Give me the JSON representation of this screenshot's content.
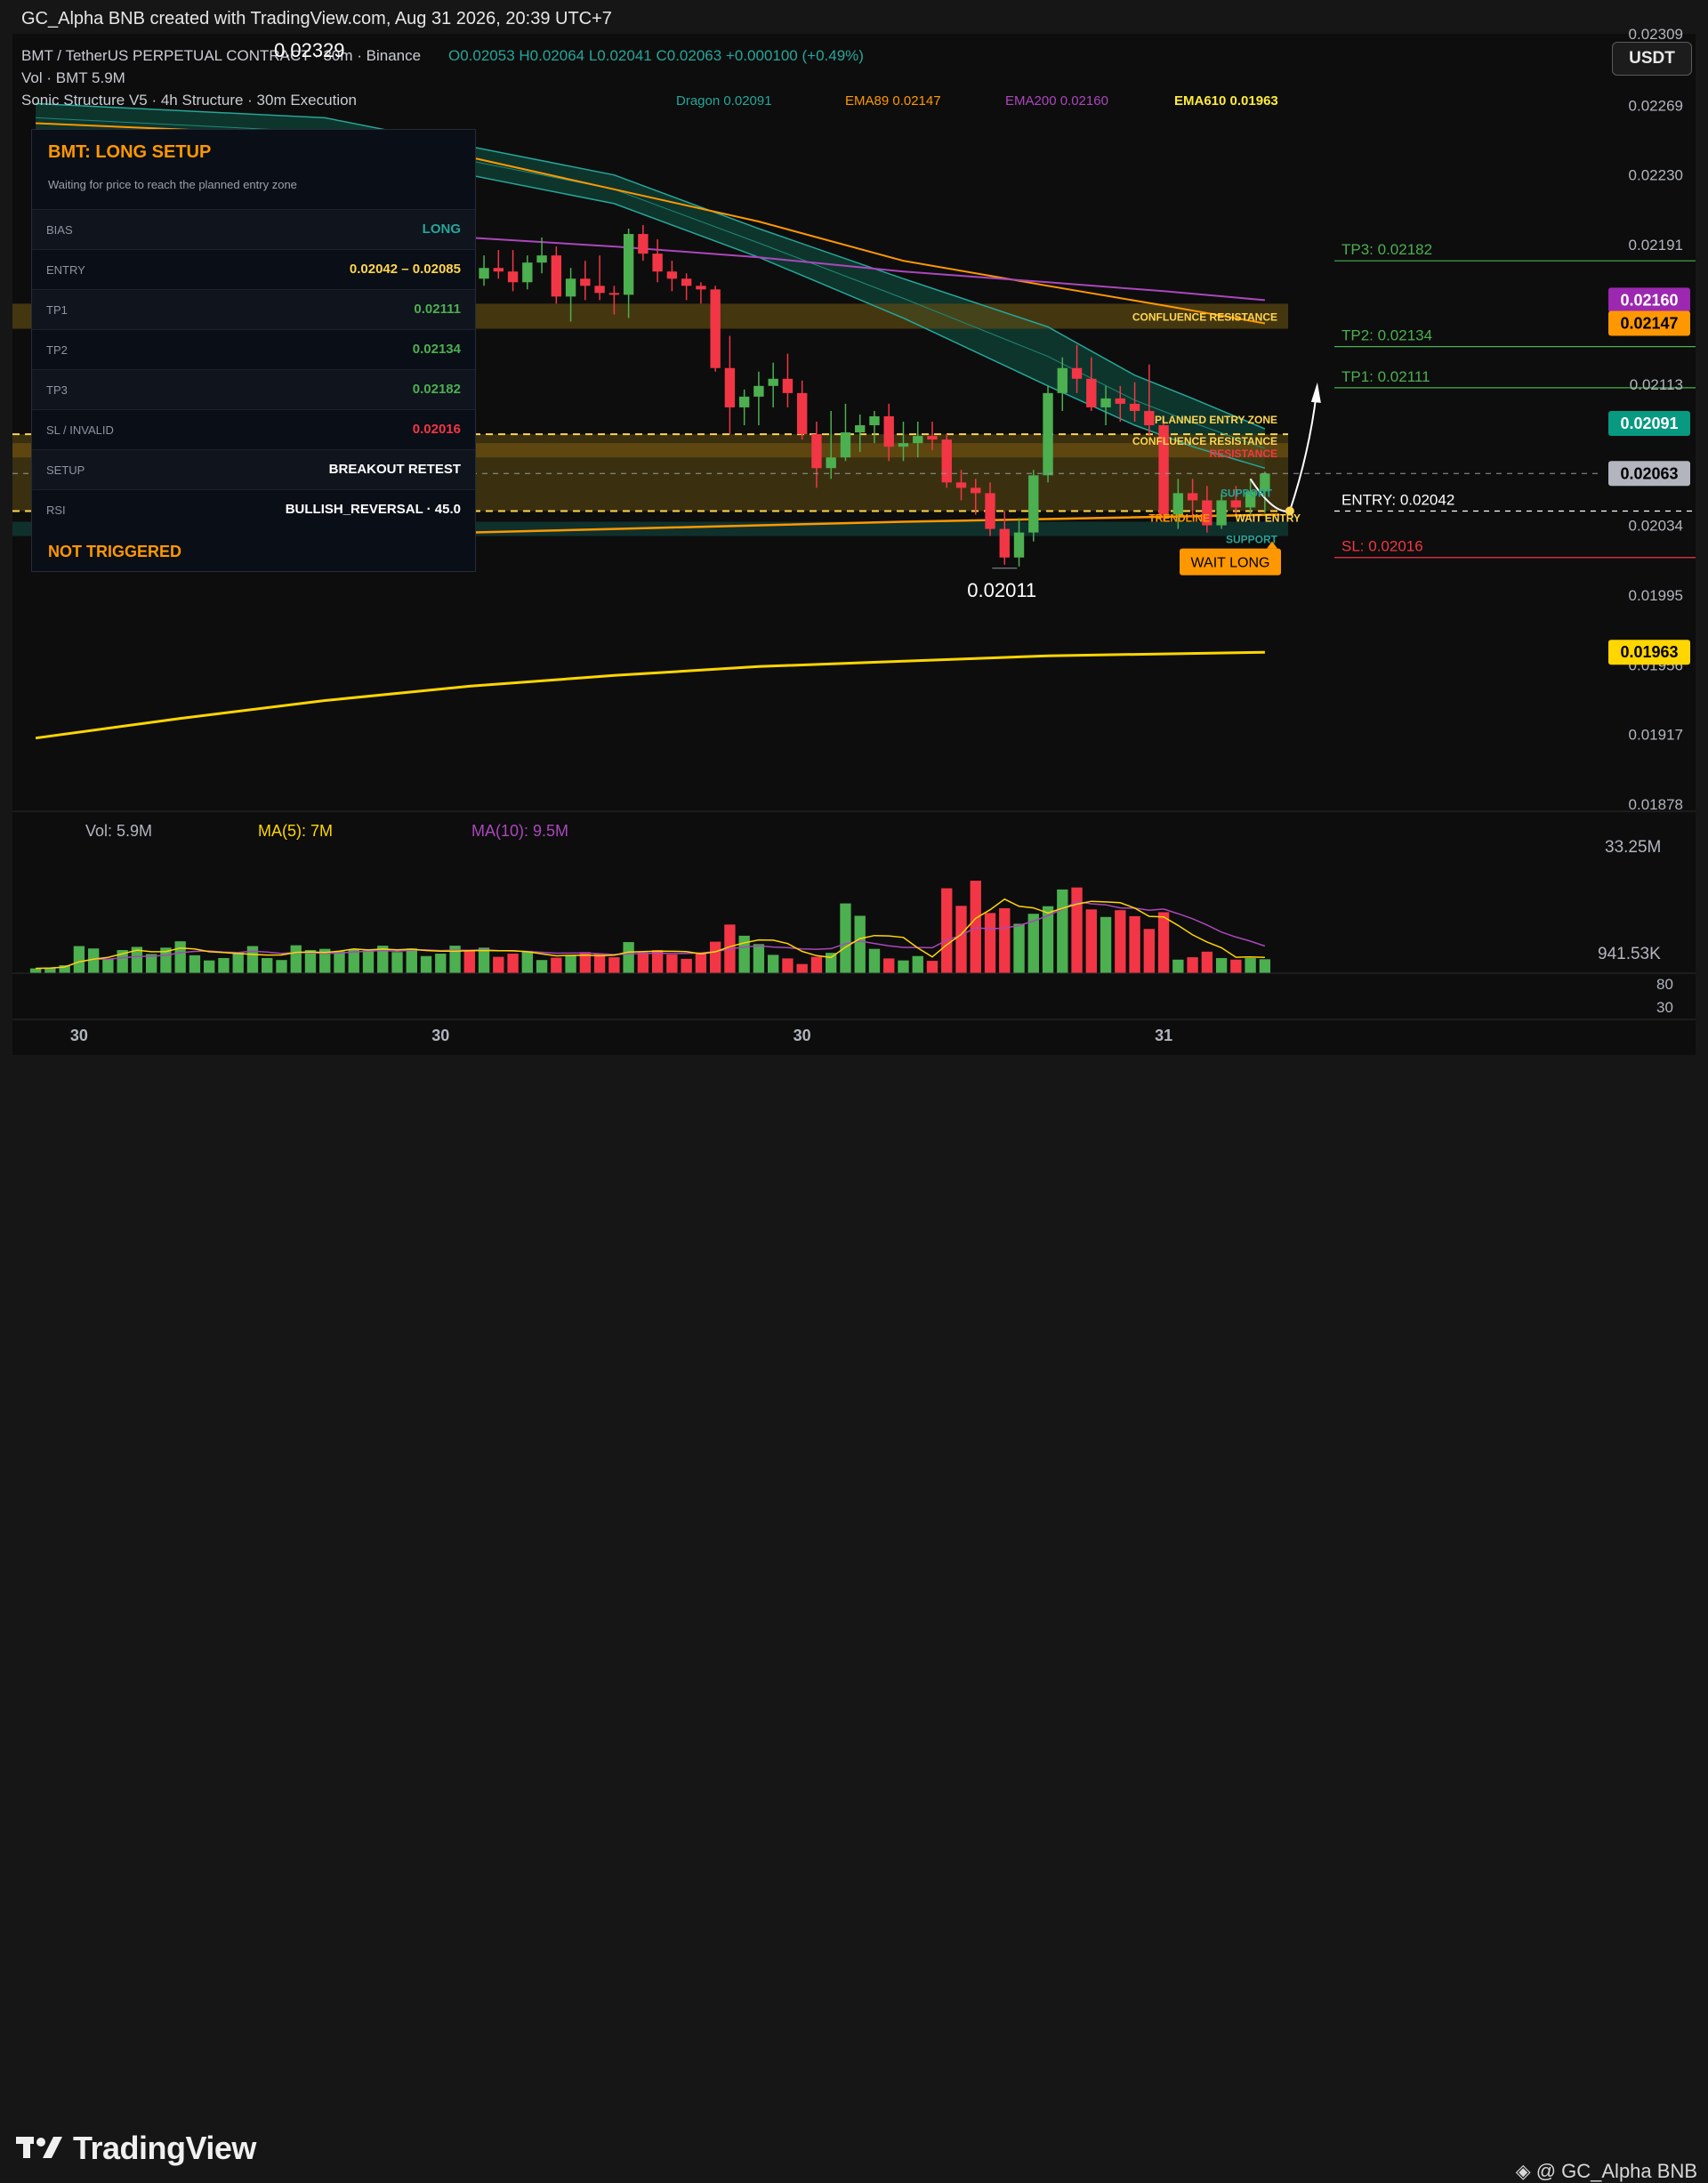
{
  "header": {
    "title": "GC_Alpha BNB created with TradingView.com, Aug 31 2026, 20:39 UTC+7"
  },
  "legend": {
    "symbol": "BMT / TetherUS PERPETUAL CONTRACT · 30m · Binance",
    "ohlc": "O0.02053 H0.02064 L0.02041 C0.02063 +0.000100 (+0.49%)",
    "vol": "Vol · BMT  5.9M",
    "indicator": "Sonic Structure V5 · 4h Structure · 30m Execution",
    "peak_label": "0.02329"
  },
  "ema_legend": [
    {
      "text": "Dragon 0.02091",
      "color": "#26a69a"
    },
    {
      "text": "EMA89 0.02147",
      "color": "#ff9800"
    },
    {
      "text": "EMA200 0.02160",
      "color": "#ab47bc"
    },
    {
      "text": "EMA610 0.01963",
      "color": "#ffeb3b"
    }
  ],
  "currency_button": "USDT",
  "setup_panel": {
    "title": "BMT: LONG SETUP",
    "subtitle": "Waiting for price to reach the planned entry zone",
    "rows": [
      {
        "key": "BIAS",
        "value": "LONG",
        "color": "#26a69a"
      },
      {
        "key": "ENTRY",
        "value": "0.02042 – 0.02085",
        "color": "#ffd54f"
      },
      {
        "key": "TP1",
        "value": "0.02111",
        "color": "#4caf50"
      },
      {
        "key": "TP2",
        "value": "0.02134",
        "color": "#4caf50"
      },
      {
        "key": "TP3",
        "value": "0.02182",
        "color": "#4caf50"
      },
      {
        "key": "SL / INVALID",
        "value": "0.02016",
        "color": "#f23645"
      },
      {
        "key": "SETUP",
        "value": "BREAKOUT RETEST",
        "color": "#ffffff"
      },
      {
        "key": "RSI",
        "value": "BULLISH_REVERSAL · 45.0",
        "color": "#ffffff"
      }
    ],
    "status": "NOT TRIGGERED"
  },
  "chart_labels": {
    "confluence_resistance": "CONFLUENCE RESISTANCE",
    "planned_entry_zone": "PLANNED ENTRY ZONE",
    "resistance": "RESISTANCE",
    "support": "SUPPORT",
    "trendline": "TRENDLINE",
    "wait_entry": "WAIT ENTRY",
    "wait_long": "WAIT LONG",
    "low_label": "0.02011"
  },
  "targets": [
    {
      "text": "TP3: 0.02182",
      "value": 0.02182,
      "color": "#4caf50"
    },
    {
      "text": "TP2: 0.02134",
      "value": 0.02134,
      "color": "#4caf50"
    },
    {
      "text": "TP1: 0.02111",
      "value": 0.02111,
      "color": "#4caf50"
    },
    {
      "text": "ENTRY: 0.02042",
      "value": 0.02042,
      "color": "#ffffff"
    },
    {
      "text": "SL: 0.02016",
      "value": 0.02016,
      "color": "#f23645"
    }
  ],
  "price_badges": [
    {
      "text": "0.02160",
      "value": 0.0216,
      "bg": "#9c27b0",
      "fg": "#ffffff"
    },
    {
      "text": "0.02147",
      "value": 0.02147,
      "bg": "#ff9800",
      "fg": "#000000"
    },
    {
      "text": "0.02091",
      "value": 0.02091,
      "bg": "#089981",
      "fg": "#ffffff"
    },
    {
      "text": "0.02063",
      "value": 0.02063,
      "bg": "#b2b5be",
      "fg": "#000000"
    },
    {
      "text": "0.01963",
      "value": 0.01963,
      "bg": "#ffd600",
      "fg": "#000000"
    }
  ],
  "volume_legend": [
    {
      "text": "Vol: 5.9M",
      "color": "#b2b5be"
    },
    {
      "text": "MA(5): 7M",
      "color": "#ffd600"
    },
    {
      "text": "MA(10): 9.5M",
      "color": "#ab47bc"
    }
  ],
  "volume_axis": [
    "33.25M",
    "941.53K"
  ],
  "rsi_axis": [
    "80",
    "30"
  ],
  "footer": {
    "brand": "TradingView",
    "credit": "@ GC_Alpha BNB"
  },
  "chart_data": {
    "type": "candlestick",
    "price_axis": {
      "min": 0.0186,
      "max": 0.02309,
      "ticks": [
        "0.02309",
        "0.02269",
        "0.02230",
        "0.02191",
        "0.02113",
        "0.02034",
        "0.01995",
        "0.01956",
        "0.01917",
        "0.01878"
      ],
      "tick_values": [
        0.02309,
        0.02269,
        0.0223,
        0.02191,
        0.02113,
        0.02034,
        0.01995,
        0.01956,
        0.01917,
        0.01878
      ]
    },
    "x_ticks": [
      "30",
      "30",
      "30",
      "31"
    ],
    "x_tick_bars": [
      3,
      28,
      53,
      78
    ],
    "bars_visible": 86,
    "candles": [
      [
        0.0222,
        0.0222,
        0.0222,
        0.0222
      ],
      [
        0.0222,
        0.0222,
        0.0222,
        0.0222
      ],
      [
        0.0222,
        0.0222,
        0.0222,
        0.0222
      ],
      [
        0.0222,
        0.0222,
        0.0222,
        0.0222
      ],
      [
        0.0222,
        0.0222,
        0.0222,
        0.0222
      ],
      [
        0.0222,
        0.0222,
        0.0222,
        0.0222
      ],
      [
        0.0222,
        0.0222,
        0.0222,
        0.0222
      ],
      [
        0.0222,
        0.0222,
        0.0222,
        0.0222
      ],
      [
        0.0222,
        0.0222,
        0.0222,
        0.0222
      ],
      [
        0.0222,
        0.0222,
        0.0222,
        0.0222
      ],
      [
        0.0222,
        0.0222,
        0.0222,
        0.0222
      ],
      [
        0.0222,
        0.0222,
        0.0222,
        0.0222
      ],
      [
        0.0222,
        0.0222,
        0.0222,
        0.0222
      ],
      [
        0.0222,
        0.0222,
        0.0222,
        0.0222
      ],
      [
        0.0222,
        0.0222,
        0.0222,
        0.0222
      ],
      [
        0.0222,
        0.0222,
        0.0222,
        0.0222
      ],
      [
        0.0222,
        0.0222,
        0.0222,
        0.0222
      ],
      [
        0.0222,
        0.0222,
        0.0222,
        0.0222
      ],
      [
        0.0222,
        0.0222,
        0.0222,
        0.0222
      ],
      [
        0.0222,
        0.0222,
        0.0222,
        0.0222
      ],
      [
        0.0222,
        0.0222,
        0.0222,
        0.0222
      ],
      [
        0.0222,
        0.0222,
        0.0222,
        0.0222
      ],
      [
        0.0222,
        0.0222,
        0.0222,
        0.0222
      ],
      [
        0.0222,
        0.0222,
        0.0222,
        0.0222
      ],
      [
        0.0222,
        0.0222,
        0.0222,
        0.0222
      ],
      [
        0.0222,
        0.0222,
        0.0222,
        0.0222
      ],
      [
        0.0222,
        0.0222,
        0.0222,
        0.0222
      ],
      [
        0.0222,
        0.0222,
        0.0222,
        0.0222
      ],
      [
        0.0222,
        0.0222,
        0.0222,
        0.0222
      ],
      [
        0.0222,
        0.0222,
        0.0222,
        0.0222
      ],
      [
        0.0218,
        0.0219,
        0.0217,
        0.02172
      ],
      [
        0.02172,
        0.02185,
        0.02168,
        0.02178
      ],
      [
        0.02178,
        0.02188,
        0.02172,
        0.02176
      ],
      [
        0.02176,
        0.02188,
        0.02165,
        0.0217
      ],
      [
        0.0217,
        0.02185,
        0.02166,
        0.02181
      ],
      [
        0.02181,
        0.02195,
        0.02175,
        0.02185
      ],
      [
        0.02185,
        0.0219,
        0.02158,
        0.02162
      ],
      [
        0.02162,
        0.02178,
        0.02148,
        0.02172
      ],
      [
        0.02172,
        0.02182,
        0.0216,
        0.02168
      ],
      [
        0.02168,
        0.02185,
        0.0216,
        0.02164
      ],
      [
        0.02164,
        0.02168,
        0.02152,
        0.02163
      ],
      [
        0.02163,
        0.022,
        0.0215,
        0.02197
      ],
      [
        0.02197,
        0.02202,
        0.02182,
        0.02186
      ],
      [
        0.02186,
        0.02194,
        0.0217,
        0.02176
      ],
      [
        0.02176,
        0.02182,
        0.02165,
        0.02172
      ],
      [
        0.02172,
        0.02175,
        0.0216,
        0.02168
      ],
      [
        0.02168,
        0.0217,
        0.02158,
        0.02166
      ],
      [
        0.02166,
        0.02168,
        0.0212,
        0.02122
      ],
      [
        0.02122,
        0.0214,
        0.02085,
        0.021
      ],
      [
        0.021,
        0.0211,
        0.0209,
        0.02106
      ],
      [
        0.02106,
        0.0212,
        0.0209,
        0.02112
      ],
      [
        0.02112,
        0.02125,
        0.021,
        0.02116
      ],
      [
        0.02116,
        0.0213,
        0.021,
        0.02108
      ],
      [
        0.02108,
        0.02115,
        0.02082,
        0.02085
      ],
      [
        0.02085,
        0.02092,
        0.02055,
        0.02066
      ],
      [
        0.02066,
        0.02098,
        0.0206,
        0.02072
      ],
      [
        0.02072,
        0.02102,
        0.0207,
        0.02086
      ],
      [
        0.02086,
        0.02096,
        0.02075,
        0.0209
      ],
      [
        0.0209,
        0.02098,
        0.0208,
        0.02095
      ],
      [
        0.02095,
        0.02102,
        0.0207,
        0.02078
      ],
      [
        0.02078,
        0.02092,
        0.0207,
        0.0208
      ],
      [
        0.0208,
        0.02092,
        0.02072,
        0.02084
      ],
      [
        0.02084,
        0.02092,
        0.02076,
        0.02082
      ],
      [
        0.02082,
        0.02085,
        0.02055,
        0.02058
      ],
      [
        0.02058,
        0.02065,
        0.02048,
        0.02055
      ],
      [
        0.02055,
        0.0206,
        0.0204,
        0.02052
      ],
      [
        0.02052,
        0.02058,
        0.02028,
        0.02032
      ],
      [
        0.02032,
        0.02042,
        0.02012,
        0.02016
      ],
      [
        0.02016,
        0.02038,
        0.02011,
        0.0203
      ],
      [
        0.0203,
        0.02065,
        0.02025,
        0.02062
      ],
      [
        0.02062,
        0.02112,
        0.02058,
        0.02108
      ],
      [
        0.02108,
        0.02128,
        0.02098,
        0.02122
      ],
      [
        0.02122,
        0.02135,
        0.02108,
        0.02116
      ],
      [
        0.02116,
        0.02128,
        0.02098,
        0.021
      ],
      [
        0.021,
        0.02112,
        0.0209,
        0.02105
      ],
      [
        0.02105,
        0.02112,
        0.02092,
        0.02102
      ],
      [
        0.02102,
        0.02114,
        0.02092,
        0.02098
      ],
      [
        0.02098,
        0.02124,
        0.02084,
        0.0209
      ],
      [
        0.0209,
        0.02095,
        0.02036,
        0.0204
      ],
      [
        0.0204,
        0.0206,
        0.02032,
        0.02052
      ],
      [
        0.02052,
        0.0206,
        0.02038,
        0.02048
      ],
      [
        0.02048,
        0.02056,
        0.0203,
        0.02034
      ],
      [
        0.02034,
        0.02052,
        0.02032,
        0.02048
      ],
      [
        0.02048,
        0.02056,
        0.0204,
        0.02044
      ],
      [
        0.02044,
        0.0206,
        0.0204,
        0.02053
      ],
      [
        0.02053,
        0.02064,
        0.02041,
        0.02063
      ]
    ],
    "volumes": [
      1.2,
      1.4,
      2.0,
      6.8,
      6.2,
      3.5,
      5.8,
      6.6,
      4.8,
      6.4,
      8.0,
      4.5,
      3.2,
      3.8,
      5.2,
      6.8,
      3.8,
      3.3,
      7.0,
      5.8,
      6.1,
      5.5,
      6.0,
      5.7,
      6.9,
      5.3,
      6.2,
      4.3,
      4.9,
      6.9,
      5.9,
      6.4,
      4.1,
      4.9,
      5.6,
      3.3,
      3.9,
      4.6,
      5.3,
      4.8,
      4.0,
      7.8,
      5.2,
      5.8,
      4.7,
      3.6,
      4.9,
      7.9,
      12.2,
      9.4,
      7.3,
      4.6,
      3.7,
      2.3,
      4.1,
      5.1,
      17.5,
      14.4,
      6.1,
      3.7,
      3.2,
      4.3,
      3.1,
      21.3,
      16.9,
      23.2,
      15.1,
      16.3,
      12.4,
      14.9,
      16.8,
      21.0,
      21.5,
      16.0,
      14.1,
      15.8,
      14.3,
      11.1,
      15.3,
      3.4,
      4.0,
      5.4,
      3.8,
      3.4,
      3.8,
      3.5
    ],
    "ema_dragon_upper": [
      [
        0,
        0.0227
      ],
      [
        20,
        0.02262
      ],
      [
        40,
        0.0223
      ],
      [
        50,
        0.022
      ],
      [
        60,
        0.02172
      ],
      [
        70,
        0.02145
      ],
      [
        76,
        0.02118
      ],
      [
        80,
        0.02105
      ],
      [
        85,
        0.02088
      ]
    ],
    "ema_dragon_lower": [
      [
        0,
        0.02254
      ],
      [
        20,
        0.02246
      ],
      [
        40,
        0.02214
      ],
      [
        50,
        0.02184
      ],
      [
        60,
        0.0215
      ],
      [
        70,
        0.02112
      ],
      [
        76,
        0.0209
      ],
      [
        80,
        0.02078
      ],
      [
        85,
        0.02066
      ]
    ],
    "ema89": [
      [
        0,
        0.02259
      ],
      [
        20,
        0.02252
      ],
      [
        30,
        0.0224
      ],
      [
        40,
        0.02222
      ],
      [
        50,
        0.02204
      ],
      [
        60,
        0.02182
      ],
      [
        70,
        0.02168
      ],
      [
        78,
        0.02157
      ],
      [
        85,
        0.02147
      ]
    ],
    "ema200": [
      [
        0,
        0.022
      ],
      [
        20,
        0.02198
      ],
      [
        30,
        0.02195
      ],
      [
        40,
        0.0219
      ],
      [
        50,
        0.02184
      ],
      [
        60,
        0.02176
      ],
      [
        70,
        0.0217
      ],
      [
        78,
        0.02165
      ],
      [
        85,
        0.0216
      ]
    ],
    "ema610": [
      [
        0,
        0.01915
      ],
      [
        10,
        0.01926
      ],
      [
        20,
        0.01936
      ],
      [
        30,
        0.01944
      ],
      [
        40,
        0.0195
      ],
      [
        50,
        0.01955
      ],
      [
        60,
        0.01958
      ],
      [
        70,
        0.01961
      ],
      [
        85,
        0.01963
      ]
    ],
    "trendline": [
      [
        0,
        0.02024
      ],
      [
        20,
        0.02028
      ],
      [
        40,
        0.02032
      ],
      [
        60,
        0.02036
      ],
      [
        86,
        0.0204
      ]
    ]
  }
}
